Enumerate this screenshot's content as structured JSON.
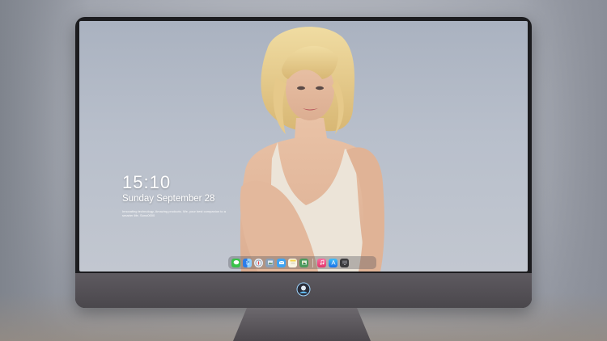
{
  "lockscreen": {
    "time": "15:10",
    "date": "Sunday September 28",
    "tagline": "Innovating technology, Amazing products. We, your best companion to a smarter life. Sono0000"
  },
  "dock": {
    "items": [
      {
        "name": "messages",
        "icon": "speech-bubble",
        "color": "#39c24a"
      },
      {
        "name": "finder",
        "icon": "face",
        "color": "#2b7de9"
      },
      {
        "name": "safari",
        "icon": "compass",
        "color": "#e9eef5"
      },
      {
        "name": "preview",
        "icon": "picture",
        "color": "#8aa0b8"
      },
      {
        "name": "mail",
        "icon": "envelope",
        "color": "#3ea3f2"
      },
      {
        "name": "notes",
        "icon": "notepad",
        "color": "#f5d34a"
      },
      {
        "name": "photos",
        "icon": "photo",
        "color": "#4c9a5c"
      },
      {
        "name": "music",
        "icon": "music-note",
        "color": "#f24e7e"
      },
      {
        "name": "app-store",
        "icon": "app-store-a",
        "color": "#2f8ff0"
      },
      {
        "name": "terminal",
        "icon": "monitor",
        "color": "#3a3a3d"
      }
    ]
  },
  "colors": {
    "screen_bg": "#aab2c0",
    "monitor_bezel": "#1c1c1f",
    "monitor_chin": "#5e5a60"
  }
}
